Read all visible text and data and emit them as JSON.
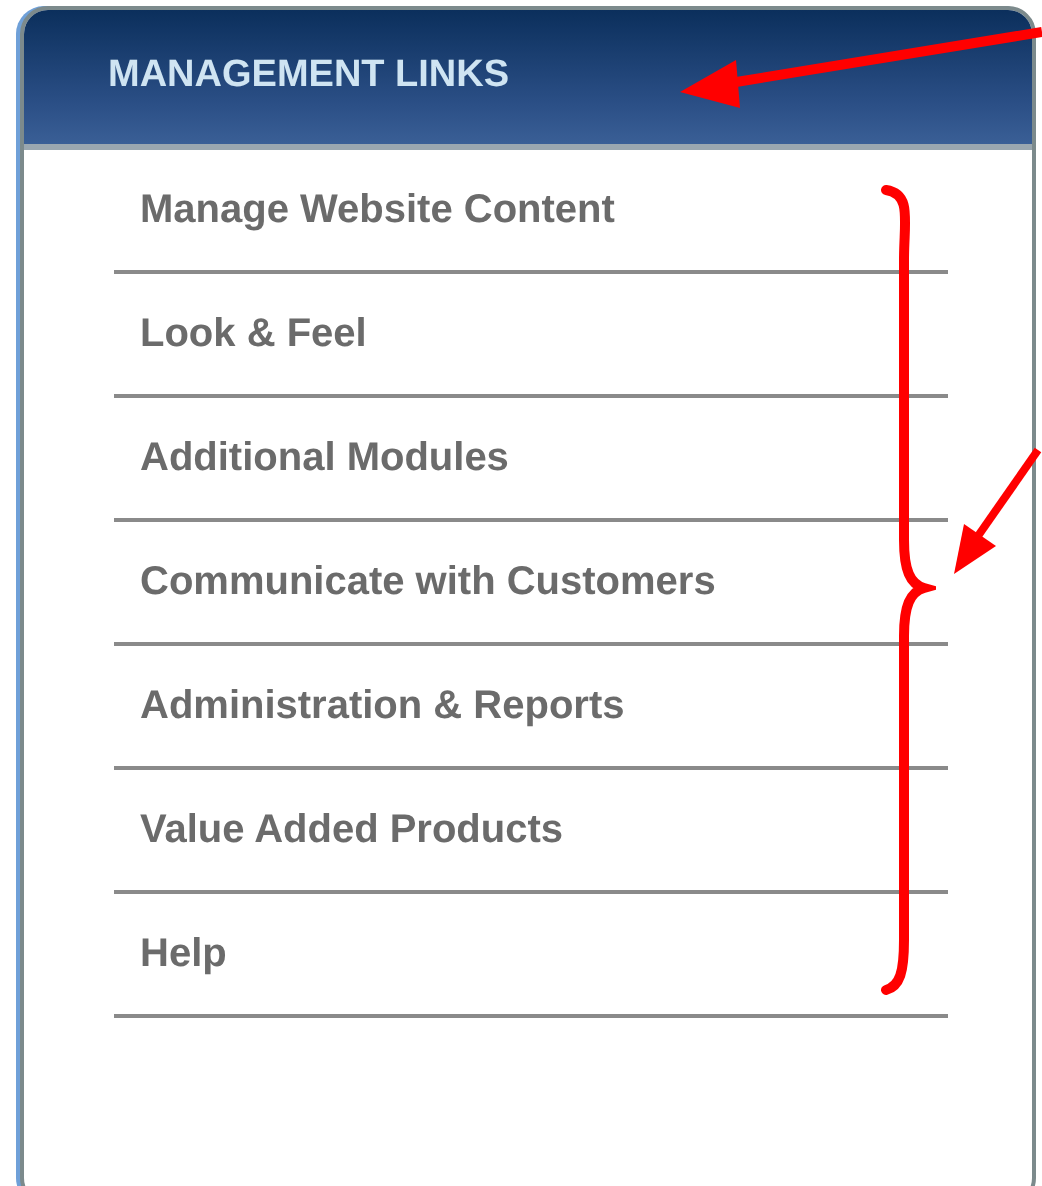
{
  "panel": {
    "title": "MANAGEMENT LINKS"
  },
  "links": [
    {
      "label": "Manage Website Content"
    },
    {
      "label": "Look & Feel"
    },
    {
      "label": "Additional Modules"
    },
    {
      "label": "Communicate with Customers"
    },
    {
      "label": "Administration & Reports"
    },
    {
      "label": "Value Added Products"
    },
    {
      "label": "Help"
    }
  ]
}
